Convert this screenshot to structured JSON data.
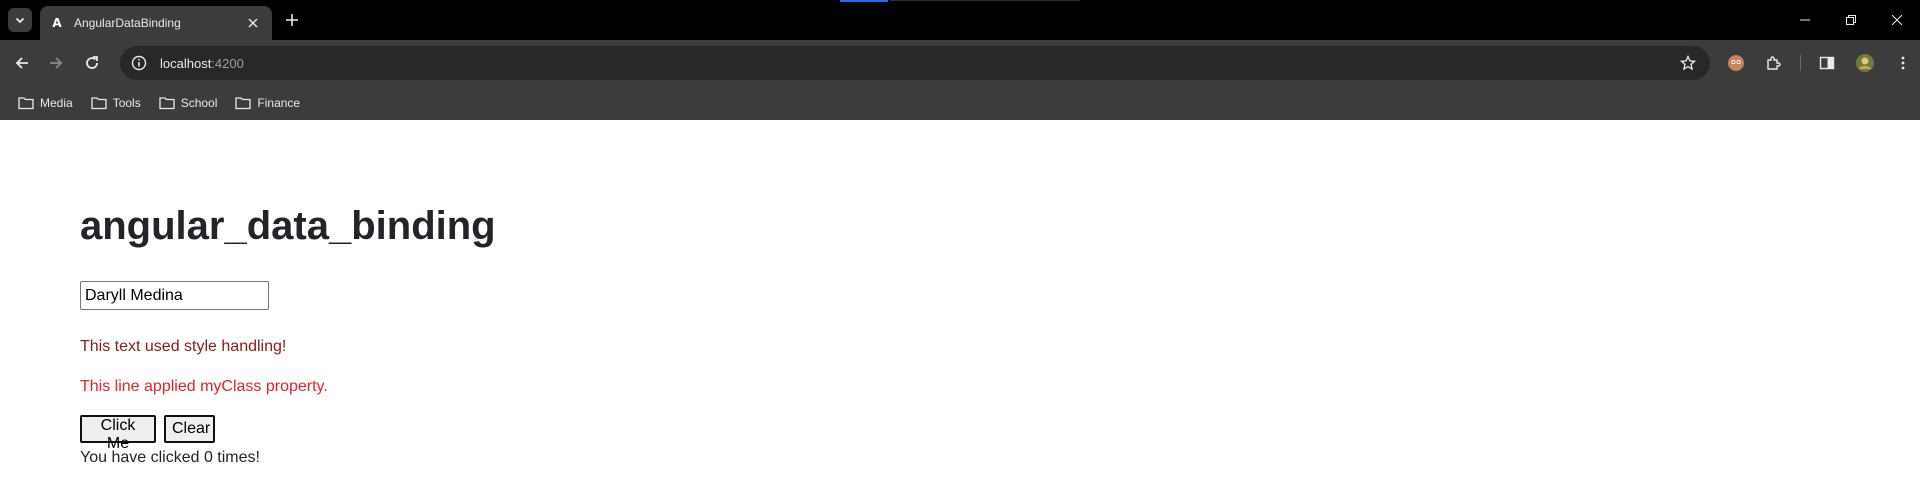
{
  "browser": {
    "tab": {
      "title": "AngularDataBinding",
      "favicon": "angular-icon"
    },
    "url": {
      "host": "localhost",
      "port": ":4200"
    },
    "bookmarks": [
      {
        "label": "Media",
        "icon": "folder-icon"
      },
      {
        "label": "Tools",
        "icon": "folder-icon"
      },
      {
        "label": "School",
        "icon": "folder-icon"
      },
      {
        "label": "Finance",
        "icon": "folder-icon"
      }
    ]
  },
  "app": {
    "title": "angular_data_binding",
    "name_input": {
      "value": "Daryll Medina"
    },
    "style_text": "This text used style handling!",
    "class_text": "This line applied myClass property.",
    "buttons": {
      "click": "Click Me",
      "clear": "Clear"
    },
    "count_text": "You have clicked 0 times!"
  },
  "colors": {
    "style_text": "#8b1a1a",
    "class_text": "#e8202a",
    "title": "#212529",
    "chrome_dark": "#3c3c3c"
  }
}
